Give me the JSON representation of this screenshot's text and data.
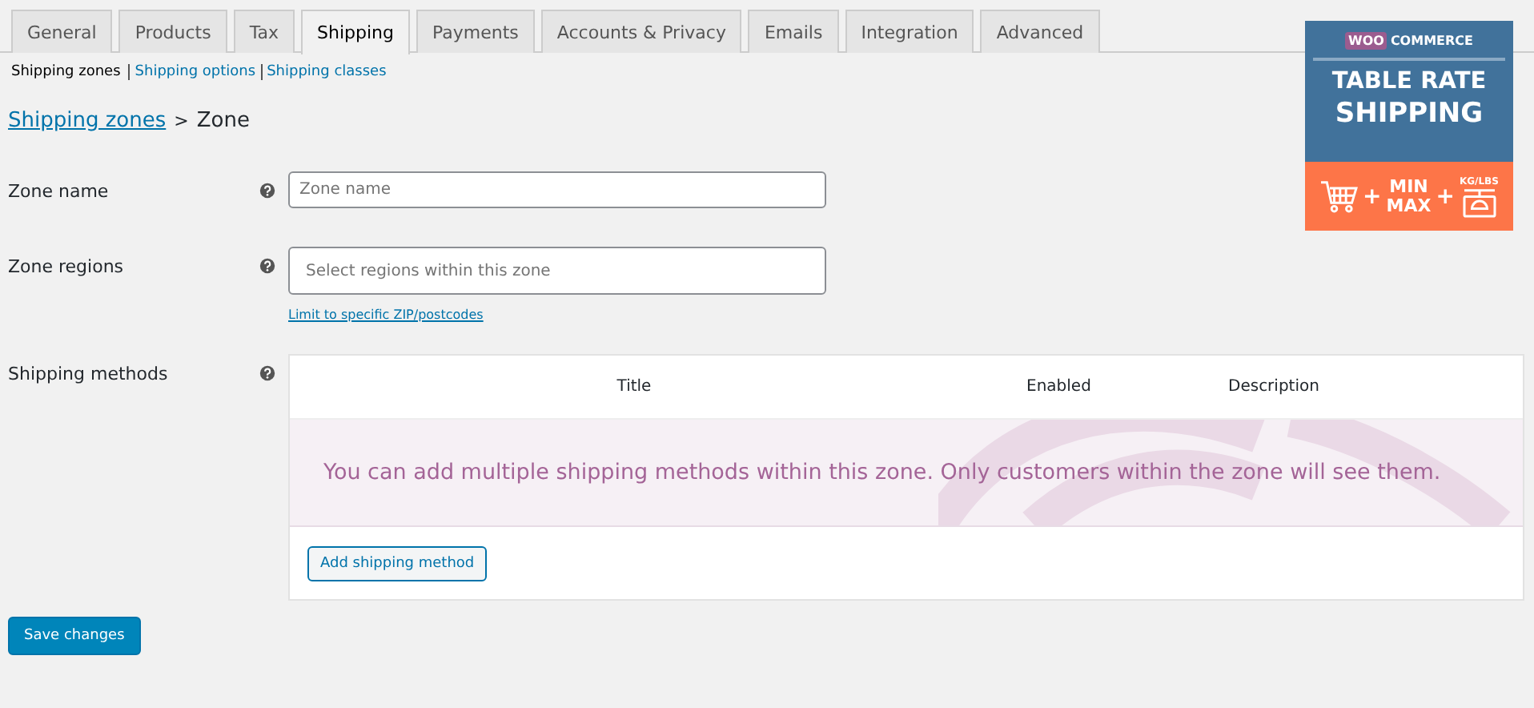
{
  "tabs": [
    {
      "label": "General",
      "selected": false
    },
    {
      "label": "Products",
      "selected": false
    },
    {
      "label": "Tax",
      "selected": false
    },
    {
      "label": "Shipping",
      "selected": true
    },
    {
      "label": "Payments",
      "selected": false
    },
    {
      "label": "Accounts & Privacy",
      "selected": false
    },
    {
      "label": "Emails",
      "selected": false
    },
    {
      "label": "Integration",
      "selected": false
    },
    {
      "label": "Advanced",
      "selected": false
    }
  ],
  "subnav": [
    {
      "label": "Shipping zones",
      "selected": true
    },
    {
      "label": "Shipping options",
      "selected": false
    },
    {
      "label": "Shipping classes",
      "selected": false
    }
  ],
  "breadcrumb": {
    "link": "Shipping zones",
    "separator": ">",
    "current": "Zone"
  },
  "fields": [
    {
      "label": "Zone name",
      "placeholder": "Zone name"
    },
    {
      "label": "Zone regions",
      "placeholder": "Select regions within this zone",
      "link": "Limit to specific ZIP/postcodes"
    }
  ],
  "shipping_methods": {
    "label": "Shipping methods",
    "columns": [
      "Title",
      "Enabled",
      "Description"
    ],
    "empty_message": "You can add multiple shipping methods within this zone. Only customers within the zone will see them.",
    "add_button": "Add shipping method"
  },
  "save_button": "Save changes",
  "banner": {
    "brand_woo": "WOO",
    "brand_commerce": "COMMERCE",
    "title_line_1": "TABLE RATE",
    "title_line_2": "SHIPPING",
    "plus_1": "+",
    "min": "MIN",
    "max": "MAX",
    "plus_2": "+",
    "units": "KG/LBS"
  }
}
